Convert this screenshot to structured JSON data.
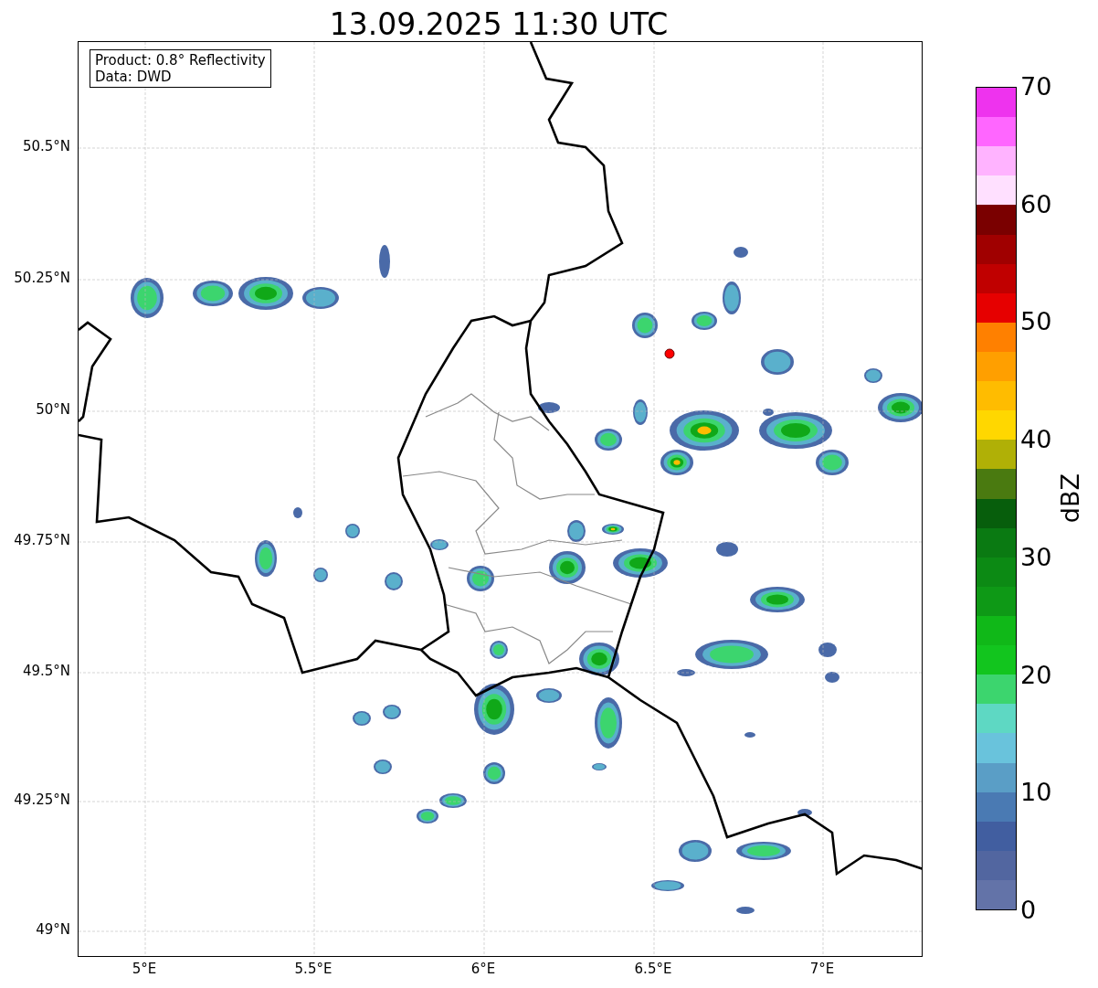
{
  "title": "13.09.2025 11:30 UTC",
  "info_box": [
    "Product: 0.8° Reflectivity",
    "Data: DWD"
  ],
  "map": {
    "lat_ticks": [
      "50.5°N",
      "50.25°N",
      "50°N",
      "49.75°N",
      "49.5°N",
      "49.25°N",
      "49°N"
    ],
    "lon_ticks": [
      "5°E",
      "5.5°E",
      "6°E",
      "6.5°E",
      "7°E"
    ]
  },
  "colorbar": {
    "label": "dBZ",
    "ticks": [
      "70",
      "60",
      "50",
      "40",
      "30",
      "20",
      "10",
      "0"
    ],
    "bands": [
      {
        "color": "#ee33ee"
      },
      {
        "color": "#ff66ff"
      },
      {
        "color": "#ffb3ff"
      },
      {
        "color": "#ffe0ff"
      },
      {
        "color": "#7a0000"
      },
      {
        "color": "#a00000"
      },
      {
        "color": "#c00000"
      },
      {
        "color": "#e60000"
      },
      {
        "color": "#ff8000"
      },
      {
        "color": "#ff9f00"
      },
      {
        "color": "#ffbc00"
      },
      {
        "color": "#ffd700"
      },
      {
        "color": "#b0b006"
      },
      {
        "color": "#4a7a10"
      },
      {
        "color": "#075e0c"
      },
      {
        "color": "#0a7a12"
      },
      {
        "color": "#0c8a14"
      },
      {
        "color": "#0e9916"
      },
      {
        "color": "#10b818"
      },
      {
        "color": "#12c51e"
      },
      {
        "color": "#3cd56e"
      },
      {
        "color": "#5ed8c3"
      },
      {
        "color": "#69c3dc"
      },
      {
        "color": "#5a9ec6"
      },
      {
        "color": "#4a7ab3"
      },
      {
        "color": "#415ea0"
      },
      {
        "color": "#5266a0"
      },
      {
        "color": "#6373a8"
      }
    ]
  }
}
